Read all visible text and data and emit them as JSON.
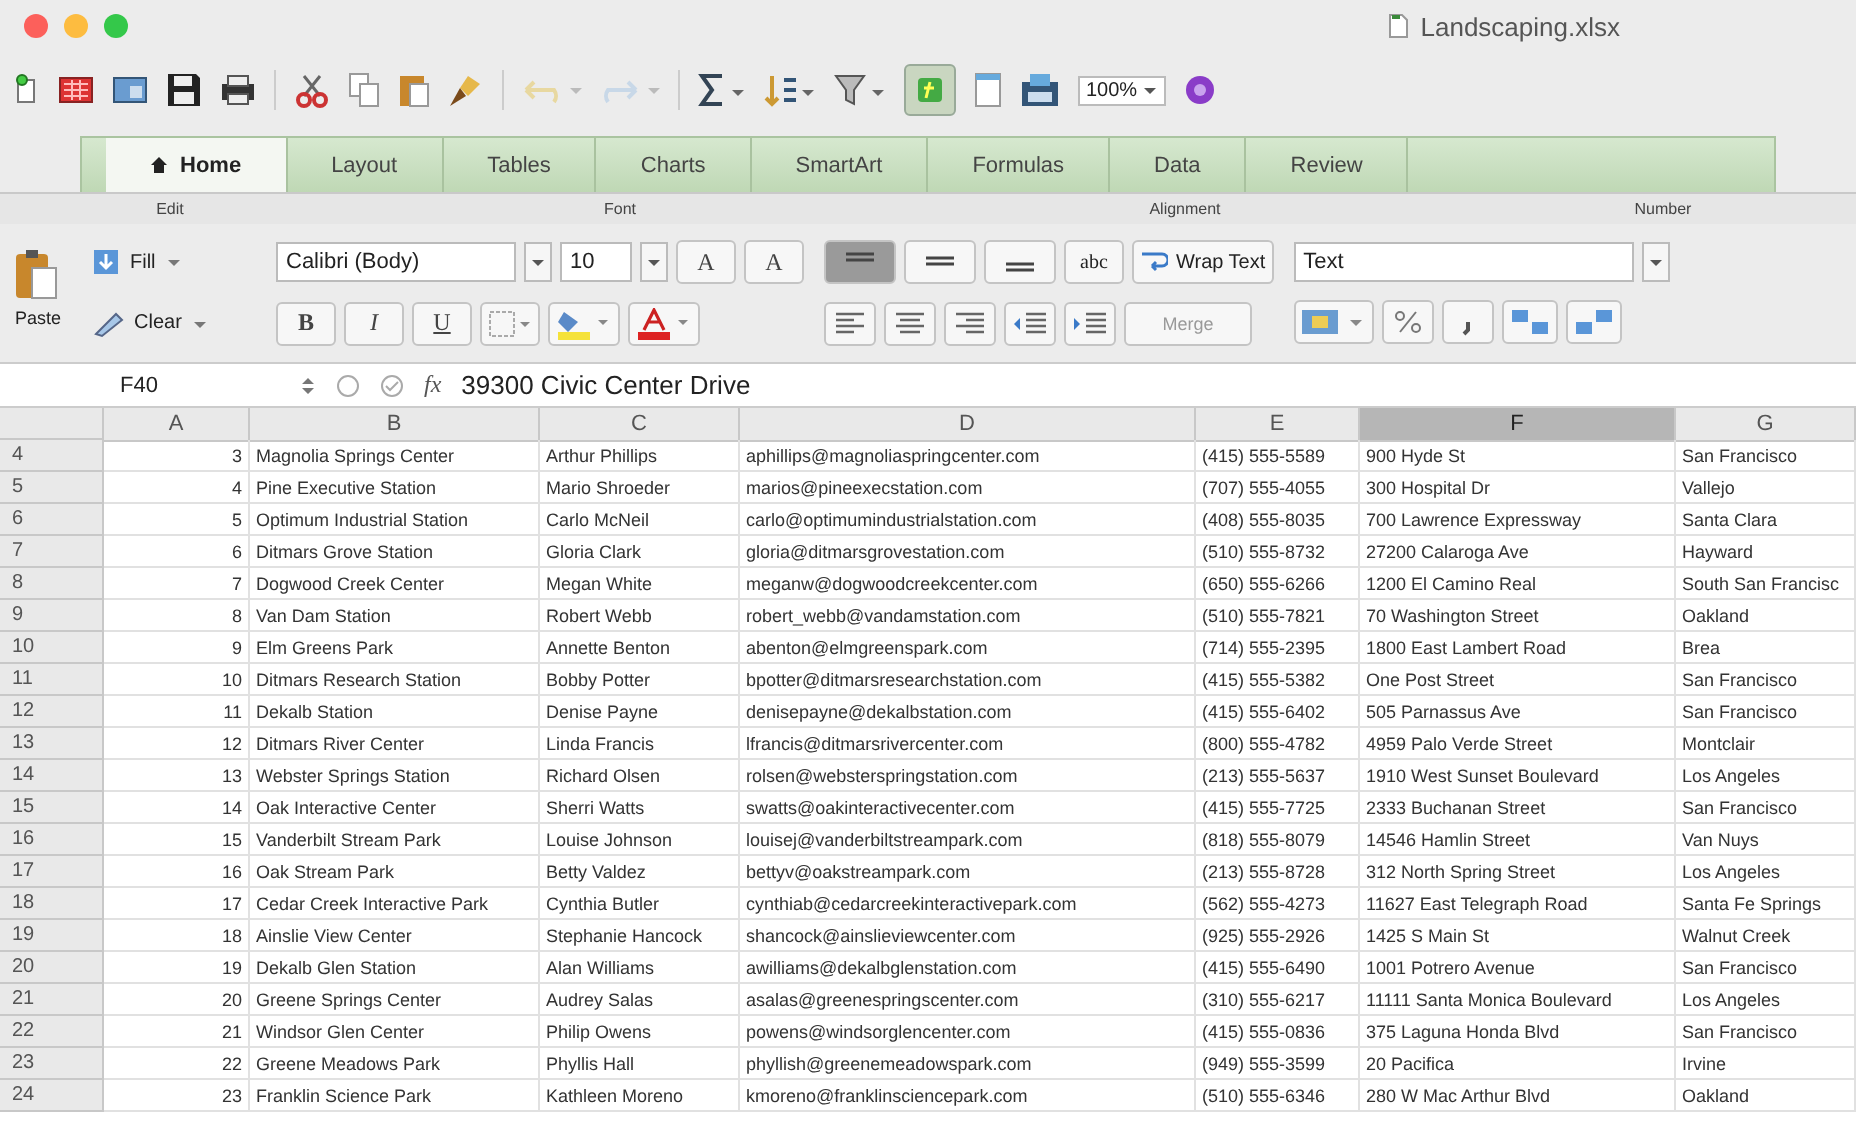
{
  "window": {
    "title": "Landscaping.xlsx"
  },
  "toolbar": {
    "zoom": "100%"
  },
  "tabs": [
    {
      "label": "Home",
      "selected": true
    },
    {
      "label": "Layout",
      "selected": false
    },
    {
      "label": "Tables",
      "selected": false
    },
    {
      "label": "Charts",
      "selected": false
    },
    {
      "label": "SmartArt",
      "selected": false
    },
    {
      "label": "Formulas",
      "selected": false
    },
    {
      "label": "Data",
      "selected": false
    },
    {
      "label": "Review",
      "selected": false
    }
  ],
  "ribbon": {
    "groups": [
      "Edit",
      "Font",
      "Alignment",
      "Number"
    ],
    "paste": "Paste",
    "fill": "Fill",
    "clear": "Clear",
    "font": "Calibri (Body)",
    "size": "10",
    "grow": "A",
    "shrink": "A",
    "bold": "B",
    "italic": "I",
    "underline": "U",
    "orientation": "abc",
    "wrap": "Wrap Text",
    "merge": "Merge",
    "format": "Text",
    "align_buttons": [
      {
        "selected": true
      },
      {
        "selected": false
      },
      {
        "selected": false
      }
    ]
  },
  "formula_bar": {
    "cell": "F40",
    "fx": "fx",
    "value": "39300 Civic Center Drive"
  },
  "columns": [
    {
      "label": "A",
      "selected": false
    },
    {
      "label": "B",
      "selected": false
    },
    {
      "label": "C",
      "selected": false
    },
    {
      "label": "D",
      "selected": false
    },
    {
      "label": "E",
      "selected": false
    },
    {
      "label": "F",
      "selected": true
    },
    {
      "label": "G",
      "selected": false
    }
  ],
  "rows": [
    {
      "row": "4",
      "cells": [
        "3",
        "Magnolia Springs Center",
        "Arthur Phillips",
        "aphillips@magnoliaspringcenter.com",
        "(415) 555-5589",
        "900 Hyde St",
        "San Francisco"
      ]
    },
    {
      "row": "5",
      "cells": [
        "4",
        "Pine Executive Station",
        "Mario Shroeder",
        "marios@pineexecstation.com",
        "(707) 555-4055",
        "300 Hospital Dr",
        "Vallejo"
      ]
    },
    {
      "row": "6",
      "cells": [
        "5",
        "Optimum Industrial Station",
        "Carlo McNeil",
        "carlo@optimumindustrialstation.com",
        "(408) 555-8035",
        "700 Lawrence Expressway",
        "Santa Clara"
      ]
    },
    {
      "row": "7",
      "cells": [
        "6",
        "Ditmars Grove Station",
        "Gloria Clark",
        "gloria@ditmarsgrovestation.com",
        "(510) 555-8732",
        "27200 Calaroga Ave",
        "Hayward"
      ]
    },
    {
      "row": "8",
      "cells": [
        "7",
        "Dogwood Creek Center",
        "Megan White",
        "meganw@dogwoodcreekcenter.com",
        "(650) 555-6266",
        "1200 El Camino Real",
        "South San Francisc"
      ]
    },
    {
      "row": "9",
      "cells": [
        "8",
        "Van Dam Station",
        "Robert Webb",
        "robert_webb@vandamstation.com",
        "(510) 555-7821",
        "70 Washington Street",
        "Oakland"
      ]
    },
    {
      "row": "10",
      "cells": [
        "9",
        "Elm Greens Park",
        "Annette Benton",
        "abenton@elmgreenspark.com",
        "(714) 555-2395",
        "1800 East Lambert Road",
        "Brea"
      ]
    },
    {
      "row": "11",
      "cells": [
        "10",
        "Ditmars Research Station",
        "Bobby Potter",
        "bpotter@ditmarsresearchstation.com",
        "(415) 555-5382",
        "One Post Street",
        "San Francisco"
      ]
    },
    {
      "row": "12",
      "cells": [
        "11",
        "Dekalb Station",
        "Denise Payne",
        "denisepayne@dekalbstation.com",
        "(415) 555-6402",
        "505 Parnassus Ave",
        "San Francisco"
      ]
    },
    {
      "row": "13",
      "cells": [
        "12",
        "Ditmars River Center",
        "Linda Francis",
        "lfrancis@ditmarsrivercenter.com",
        "(800) 555-4782",
        "4959 Palo Verde Street",
        "Montclair"
      ]
    },
    {
      "row": "14",
      "cells": [
        "13",
        "Webster Springs Station",
        "Richard Olsen",
        "rolsen@websterspringstation.com",
        "(213) 555-5637",
        "1910 West Sunset Boulevard",
        "Los Angeles"
      ]
    },
    {
      "row": "15",
      "cells": [
        "14",
        "Oak Interactive Center",
        "Sherri Watts",
        "swatts@oakinteractivecenter.com",
        "(415) 555-7725",
        "2333 Buchanan Street",
        "San Francisco"
      ]
    },
    {
      "row": "16",
      "cells": [
        "15",
        "Vanderbilt Stream Park",
        "Louise Johnson",
        "louisej@vanderbiltstreampark.com",
        "(818) 555-8079",
        "14546 Hamlin Street",
        "Van Nuys"
      ]
    },
    {
      "row": "17",
      "cells": [
        "16",
        "Oak Stream Park",
        "Betty Valdez",
        "bettyv@oakstreampark.com",
        "(213) 555-8728",
        "312 North Spring Street",
        "Los Angeles"
      ]
    },
    {
      "row": "18",
      "cells": [
        "17",
        "Cedar Creek Interactive Park",
        "Cynthia Butler",
        "cynthiab@cedarcreekinteractivepark.com",
        "(562) 555-4273",
        "11627 East Telegraph Road",
        "Santa Fe Springs"
      ]
    },
    {
      "row": "19",
      "cells": [
        "18",
        "Ainslie View Center",
        "Stephanie Hancock",
        "shancock@ainslieviewcenter.com",
        "(925) 555-2926",
        "1425 S Main St",
        "Walnut Creek"
      ]
    },
    {
      "row": "20",
      "cells": [
        "19",
        "Dekalb Glen Station",
        "Alan Williams",
        "awilliams@dekalbglenstation.com",
        "(415) 555-6490",
        "1001 Potrero Avenue",
        "San Francisco"
      ]
    },
    {
      "row": "21",
      "cells": [
        "20",
        "Greene Springs Center",
        "Audrey Salas",
        "asalas@greenespringscenter.com",
        "(310) 555-6217",
        "11111 Santa Monica Boulevard",
        "Los Angeles"
      ]
    },
    {
      "row": "22",
      "cells": [
        "21",
        "Windsor Glen Center",
        "Philip Owens",
        "powens@windsorglencenter.com",
        "(415) 555-0836",
        "375 Laguna Honda Blvd",
        "San Francisco"
      ]
    },
    {
      "row": "23",
      "cells": [
        "22",
        "Greene Meadows Park",
        "Phyllis Hall",
        "phyllish@greenemeadowspark.com",
        "(949) 555-3599",
        "20 Pacifica",
        "Irvine"
      ]
    },
    {
      "row": "24",
      "cells": [
        "23",
        "Franklin Science Park",
        "Kathleen Moreno",
        "kmoreno@franklinsciencepark.com",
        "(510) 555-6346",
        "280 W Mac Arthur Blvd",
        "Oakland"
      ]
    }
  ]
}
